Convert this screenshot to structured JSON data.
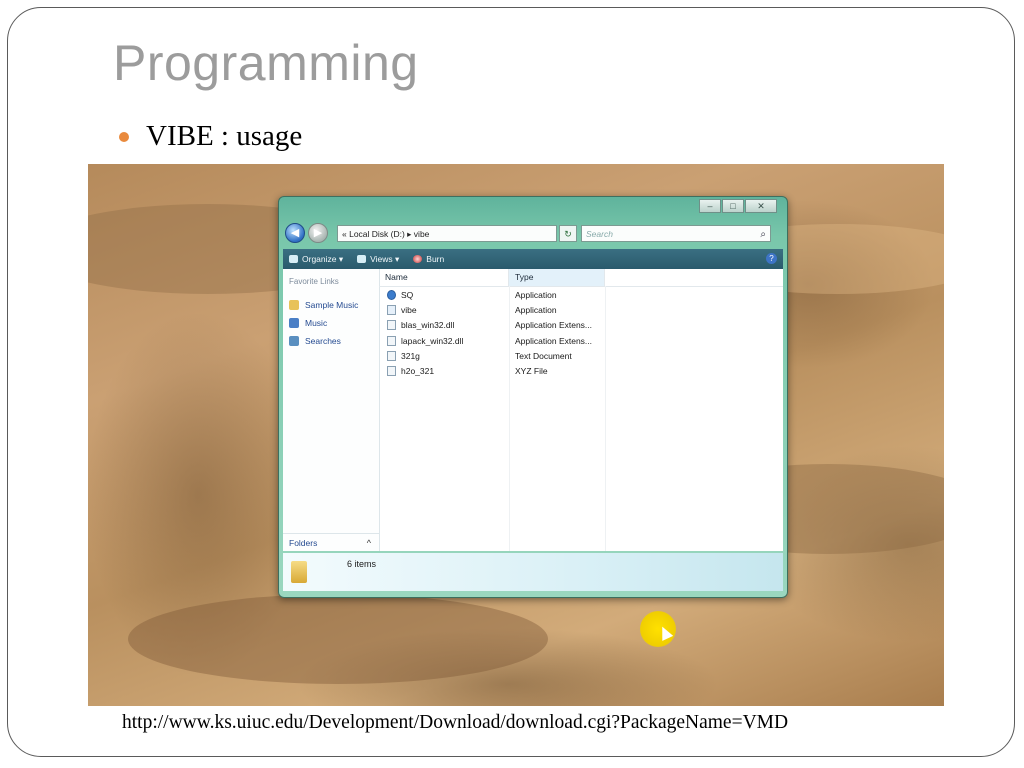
{
  "slide": {
    "title": "Programming",
    "bullet": "VIBE : usage",
    "url": "http://www.ks.uiuc.edu/Development/Download/download.cgi?PackageName=VMD"
  },
  "explorer": {
    "window_controls": [
      "–",
      "□",
      "✕"
    ],
    "address": {
      "back_icon": "back-arrow-icon",
      "forward_icon": "forward-arrow-icon",
      "path": "« Local Disk (D:) ▸ vibe",
      "search_placeholder": "Search"
    },
    "toolbar": {
      "organize": "Organize ▾",
      "views": "Views ▾",
      "burn": "Burn"
    },
    "nav_pane": {
      "favorite_links_label": "Favorite Links",
      "items": [
        "Sample Music",
        "Music",
        "Searches"
      ],
      "folders_label": "Folders",
      "folders_chevron": "^"
    },
    "columns": [
      "Name",
      "Type"
    ],
    "files": [
      {
        "name": "SQ",
        "type": "Application",
        "icon": "app-icon"
      },
      {
        "name": "vibe",
        "type": "Application",
        "icon": "window-app-icon"
      },
      {
        "name": "blas_win32.dll",
        "type": "Application Extens...",
        "icon": "dll-icon"
      },
      {
        "name": "lapack_win32.dll",
        "type": "Application Extens...",
        "icon": "dll-icon"
      },
      {
        "name": "321g",
        "type": "Text Document",
        "icon": "text-doc-icon"
      },
      {
        "name": "h2o_321",
        "type": "XYZ File",
        "icon": "file-icon"
      }
    ],
    "status": "6 items"
  },
  "colors": {
    "title_gray": "#9c9c9c",
    "bullet_orange": "#e98a3d",
    "vista_teal": "#5fb39c",
    "cursor_highlight": "#ffe100"
  }
}
